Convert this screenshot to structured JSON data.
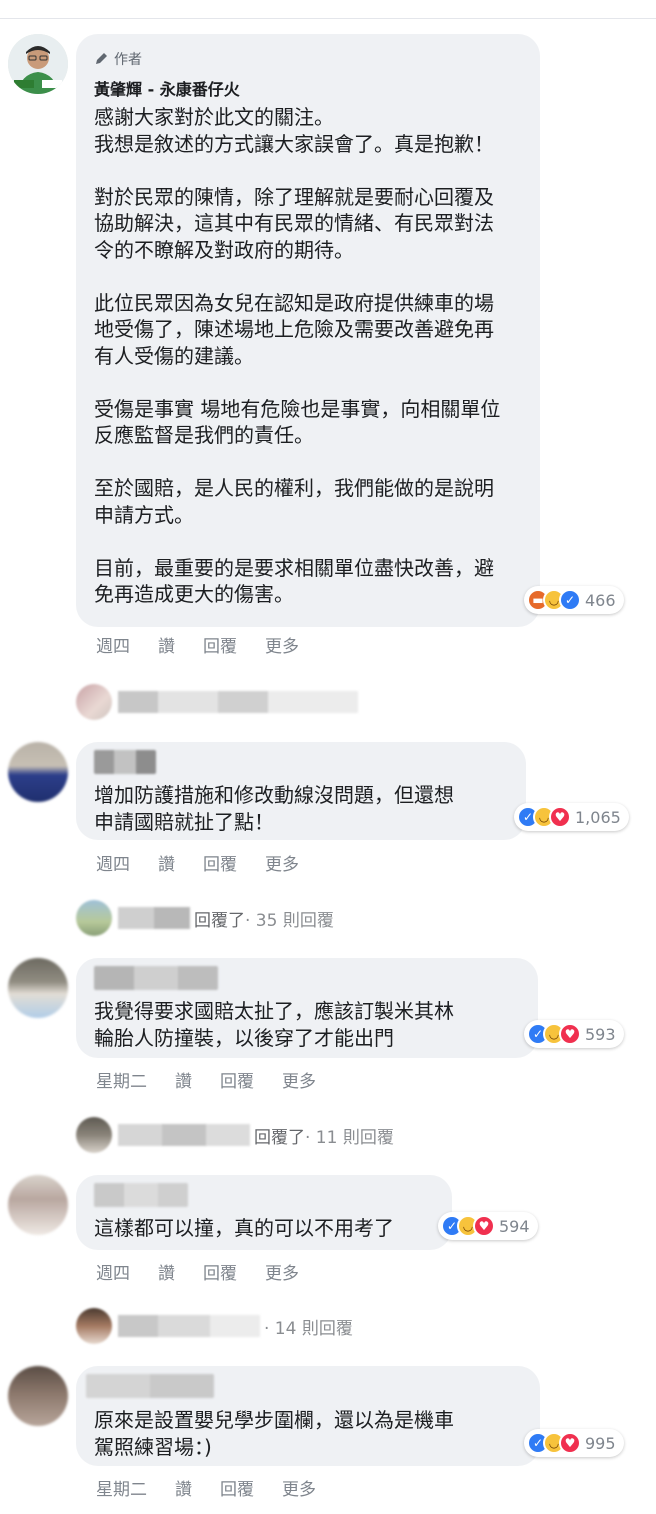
{
  "author_comment": {
    "badge": "作者",
    "name": "黃肇輝 - 永康番仔火",
    "text": "感謝大家對於此文的關注。\n我想是敘述的方式讓大家誤會了。真是抱歉！\n\n對於民眾的陳情，除了理解就是要耐心回覆及協助解決，這其中有民眾的情緒、有民眾對法令的不瞭解及對政府的期待。\n\n此位民眾因為女兒在認知是政府提供練車的場地受傷了，陳述場地上危險及需要改善避免再有人受傷的建議。\n\n受傷是事實 場地有危險也是事實，向相關單位反應監督是我們的責任。\n\n至於國賠，是人民的權利，我們能做的是說明申請方式。\n\n目前，最重要的是要求相關單位盡快改善，避免再造成更大的傷害。",
    "reactions_count": "466",
    "actions": {
      "time": "週四",
      "like": "讚",
      "reply": "回覆",
      "more": "更多"
    }
  },
  "reply_summary_1": {
    "text": ""
  },
  "comment_1": {
    "text": "增加防護措施和修改動線沒問題，但還想\n申請國賠就扯了點！",
    "reactions_count": "1,065",
    "actions": {
      "time": "週四",
      "like": "讚",
      "reply": "回覆",
      "more": "更多"
    }
  },
  "reply_summary_2": {
    "suffix": "回覆了",
    "count": " · 35 則回覆"
  },
  "comment_2": {
    "text": "我覺得要求國賠太扯了，應該訂製米其林\n輪胎人防撞裝，以後穿了才能出門",
    "reactions_count": "593",
    "actions": {
      "time": "星期二",
      "like": "讚",
      "reply": "回覆",
      "more": "更多"
    }
  },
  "reply_summary_3": {
    "suffix": "回覆了",
    "count": " · 11 則回覆"
  },
  "comment_3": {
    "text": "這樣都可以撞，真的可以不用考了",
    "reactions_count": "594",
    "actions": {
      "time": "週四",
      "like": "讚",
      "reply": "回覆",
      "more": "更多"
    }
  },
  "reply_summary_4": {
    "count": " · 14 則回覆"
  },
  "comment_4": {
    "text": "原來是設置嬰兒學步圍欄，還以為是機車\n駕照練習場：)",
    "reactions_count": "995",
    "actions": {
      "time": "星期二",
      "like": "讚",
      "reply": "回覆",
      "more": "更多"
    }
  },
  "colors": {
    "bubble": "#eff1f4",
    "like": "#2f7bf5",
    "love": "#f0304f",
    "haha": "#f7c33c",
    "angry": "#e66a2a",
    "meta": "#7f858d"
  },
  "icons": [
    "pencil-icon",
    "like-reaction-icon",
    "haha-reaction-icon",
    "love-reaction-icon",
    "angry-reaction-icon"
  ]
}
